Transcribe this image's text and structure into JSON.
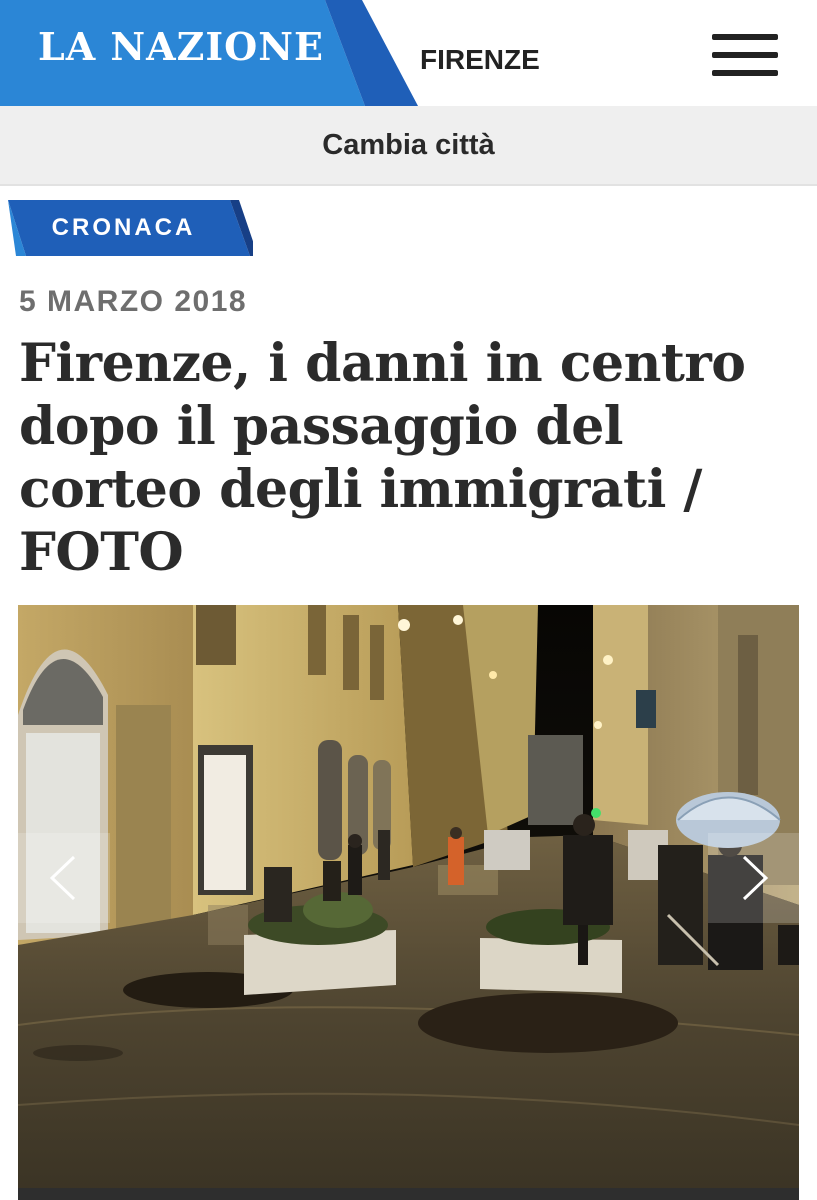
{
  "header": {
    "brand": "LA NAZIONE",
    "city": "FIRENZE",
    "menu_icon": "hamburger-menu-icon",
    "brand_color": "#2b7ccf",
    "accent_color": "#1f5fb8"
  },
  "city_bar": {
    "label": "Cambia città"
  },
  "article": {
    "category": "CRONACA",
    "date": "5 MARZO 2018",
    "title": "Firenze, i danni in centro dopo il passaggio del corteo degli immigrati / FOTO"
  },
  "gallery": {
    "prev_icon": "chevron-left-icon",
    "next_icon": "chevron-right-icon"
  }
}
